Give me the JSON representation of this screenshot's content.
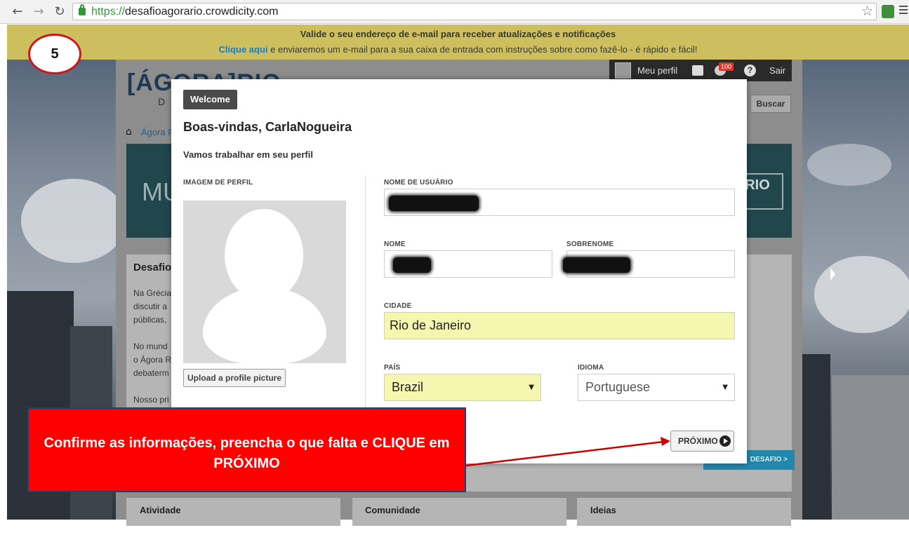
{
  "browser": {
    "url_protocol": "https://",
    "url_host": "desafioagorario.crowdicity.com",
    "back_icon": "back-arrow-icon",
    "forward_icon": "forward-arrow-icon",
    "reload_icon": "reload-icon",
    "star_icon": "bookmark-star-icon"
  },
  "notification": {
    "line1": "Valide o seu endereço de e-mail para receber atualizações e notificações",
    "link": "Clique aqui",
    "line2_rest": " e enviaremos um e-mail para a sua caixa de entrada com instruções sobre como fazê-lo - é rápido e fácil!"
  },
  "step_badge": "5",
  "site": {
    "logo": "[ÁGORA]RIO",
    "logo_sub": "D E",
    "user_bar": {
      "profile": "Meu perfil",
      "notif_count": "100",
      "help": "?",
      "exit": "Sair"
    },
    "search_button": "Buscar",
    "breadcrumb": "Ágora R",
    "hero_text": "MU",
    "hero_logo": "RIO",
    "panel_title": "Desafio",
    "panel_lines": [
      "Na Grécia",
      "discutir a",
      "públicas,",
      "",
      "No mund",
      "o Ágora R",
      "debaterm",
      "",
      "Nosso pri"
    ],
    "panel_button": "DESAFIO >",
    "columns": [
      "Atividade",
      "Comunidade",
      "Ideias"
    ]
  },
  "modal": {
    "tag": "Welcome",
    "greeting": "Boas-vindas, CarlaNogueira",
    "subhead": "Vamos trabalhar em seu perfil",
    "profile_image_label": "IMAGEM DE PERFIL",
    "upload_button": "Upload a profile picture",
    "username_label": "NOME DE USUÁRIO",
    "first_name_label": "NOME",
    "last_name_label": "SOBRENOME",
    "city_label": "CIDADE",
    "city_value": "Rio de Janeiro",
    "country_label": "PAÍS",
    "country_value": "Brazil",
    "language_label": "IDIOMA",
    "language_value": "Portuguese",
    "next_button": "PRÓXIMO"
  },
  "callout": {
    "line1": "Confirme as informações, preencha o que falta e CLIQUE em",
    "line2": "PRÓXIMO"
  },
  "colors": {
    "notification_bg": "#cdbf5e",
    "callout_red": "#ff0000",
    "highlight_field": "#f5f7b0",
    "link_blue": "#1a7cc4"
  }
}
